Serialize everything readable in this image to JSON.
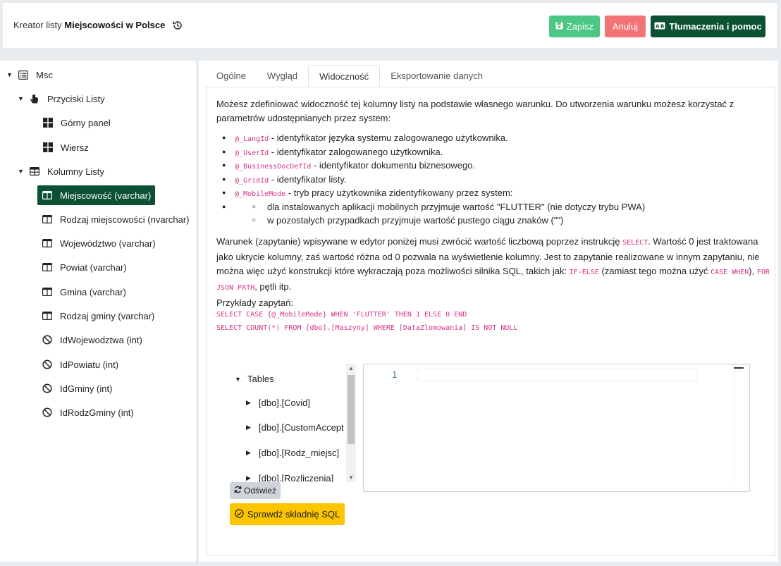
{
  "header": {
    "title_prefix": "Kreator listy",
    "title_name": "Miejscowości w Polsce",
    "history_icon": "history-icon",
    "save_label": "Zapisz",
    "cancel_label": "Anuluj",
    "help_label": "Tłumaczenia i pomoc"
  },
  "tree": {
    "root": "Msc",
    "buttons_group": "Przyciski Listy",
    "buttons": [
      "Górny panel",
      "Wiersz"
    ],
    "columns_group": "Kolumny Listy",
    "columns": [
      "Miejscowość (varchar)",
      "Rodzaj miejscowości (nvarchar)",
      "Województwo (varchar)",
      "Powiat (varchar)",
      "Gmina (varchar)",
      "Rodzaj gminy (varchar)"
    ],
    "hidden_columns": [
      "IdWojewodztwa (int)",
      "IdPowiatu (int)",
      "IdGminy (int)",
      "IdRodzGminy (int)"
    ]
  },
  "tabs": [
    "Ogólne",
    "Wygląd",
    "Widoczność",
    "Eksportowanie danych"
  ],
  "active_tab": "Widoczność",
  "content": {
    "intro_1": "Możesz zdefiniować widoczność tej kolumny listy na podstawie własnego warunku. Do utworzenia warunku możesz korzystać z",
    "intro_2": "parametrów udostępnianych przez system:",
    "params": [
      {
        "code": "@_LangId",
        "desc": " - identyfikator języka systemu zalogowanego użytkownika."
      },
      {
        "code": "@_UserId",
        "desc": " - identyfikator zalogowanego użytkownika."
      },
      {
        "code": "@_BusinessDocDefId",
        "desc": " - identyfikator dokumentu biznesowego."
      },
      {
        "code": "@_GridId",
        "desc": " - identyfikator listy."
      },
      {
        "code": "@_MobileMode",
        "desc": " - tryb pracy użytkownika zidentyfikowany przez system:"
      }
    ],
    "mobile_sub": [
      "dla instalowanych aplikacji mobilnych przyjmuje wartość \"FLUTTER\" (nie dotyczy trybu PWA)",
      "w pozostałych przypadkach przyjmuje wartość pustego ciągu znaków (\"\")"
    ],
    "cond_1a": "Warunek (zapytanie) wpisywane w edytor poniżej musi zwrócić wartość liczbową poprzez instrukcję ",
    "cond_1_code": "SELECT",
    "cond_1b": ". Wartość 0 jest traktowana",
    "cond_2": "jako ukrycie kolumny, zaś wartość różna od 0 pozwala na wyświetlenie kolumny. Jest to zapytanie realizowane w innym zapytaniu, nie",
    "cond_3a": "można więc użyć konstrukcji które wykraczają poza możliwości silnika SQL, takich jak: ",
    "cond_3_code1": "IF-ELSE",
    "cond_3b": " (zamiast tego można użyć ",
    "cond_3_code2": "CASE WHEN",
    "cond_3c": "), ",
    "cond_3_code3": "FOR",
    "cond_4_code": "JSON PATH",
    "cond_4b": ", pętli itp.",
    "examples_label": "Przykłady zapytań:",
    "example_1": "SELECT CASE {@_MobileMode} WHEN 'FLUTTER' THEN 1 ELSE 0 END",
    "example_2": "SELECT COUNT(*) FROM [dbo].[Maszyny] WHERE [DataZlomowania] IS NOT NULL"
  },
  "tables_tree": {
    "root": "Tables",
    "items": [
      "[dbo].[Covid]",
      "[dbo].[CustomAccept",
      "[dbo].[Rodz_miejsc]",
      "[dbo].[Rozliczenia]"
    ]
  },
  "editor": {
    "line_number": "1"
  },
  "refresh_label": "Odśwież",
  "check_sql_label": "Sprawdź składnię SQL",
  "colors": {
    "save": "#4cc784",
    "cancel": "#f27476",
    "primary": "#0b5132",
    "warning": "#fdc400",
    "code": "#d63384"
  }
}
